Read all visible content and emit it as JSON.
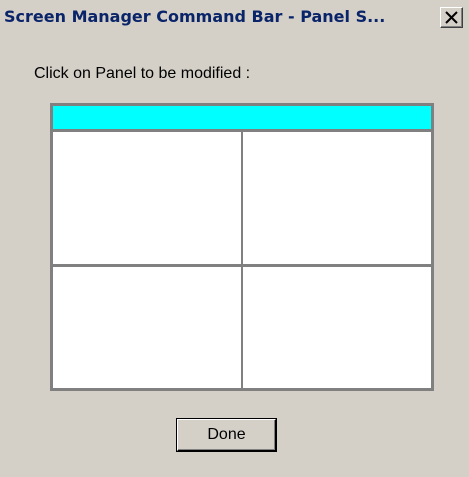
{
  "window": {
    "title": "Screen Manager Command Bar - Panel S..."
  },
  "dialog": {
    "prompt": "Click on Panel to be modified :",
    "done_label": "Done"
  },
  "colors": {
    "selected_panel": "#00ffff",
    "panel": "#ffffff",
    "dialog_background": "#d4d0c8"
  },
  "icons": {
    "close": "close-icon"
  }
}
